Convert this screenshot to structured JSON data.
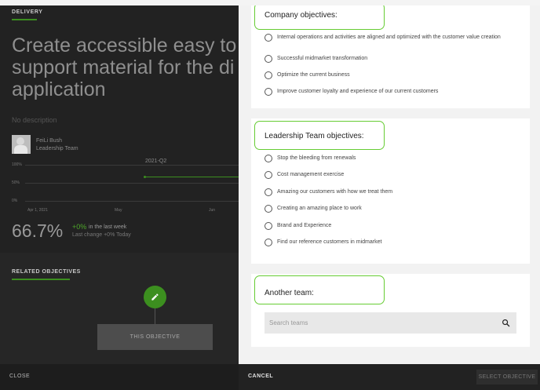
{
  "background_page": {
    "tab": "DELIVERY",
    "headline": "Create accessible easy to support material for the di application",
    "description": "No description",
    "owner": {
      "name": "FeiLi Bush",
      "team": "Leadership Team"
    },
    "chart": {
      "quarter": "2021-Q2",
      "y_ticks": [
        "100%",
        "50%",
        "0%"
      ],
      "x_ticks": [
        "Apr 1, 2021",
        "May",
        "Jun"
      ]
    },
    "progress": {
      "value": "66.7%",
      "delta": "+0%",
      "delta_suffix": "in the last week",
      "last_change": "Last change +0% Today"
    },
    "related_tab": "RELATED OBJECTIVES",
    "this_objective": "THIS OBJECTIVE",
    "close_label": "CLOSE"
  },
  "modal": {
    "company": {
      "title": "Company objectives:",
      "options": [
        "Internal operations and activities are aligned and optimized with the customer value creation",
        "Successful midmarket transformation",
        "Optimize the current business",
        "Improve customer loyalty and experience of our current customers"
      ]
    },
    "leadership": {
      "title": "Leadership Team objectives:",
      "options": [
        "Stop the bleeding from renewals",
        "Cost management exercise",
        "Amazing our customers with how we treat them",
        "Creating an amazing place to work",
        "Brand and Experience",
        "Find our reference customers in midmarket"
      ]
    },
    "another": {
      "title": "Another team:",
      "search_placeholder": "Search teams",
      "search_value": ""
    },
    "actions": {
      "cancel": "CANCEL",
      "select": "SELECT OBJECTIVE"
    }
  },
  "colors": {
    "accent_green": "#3c8f1f",
    "highlight_green": "#66cc33"
  },
  "icons": {
    "edit": "pencil-icon",
    "search": "search-icon"
  }
}
